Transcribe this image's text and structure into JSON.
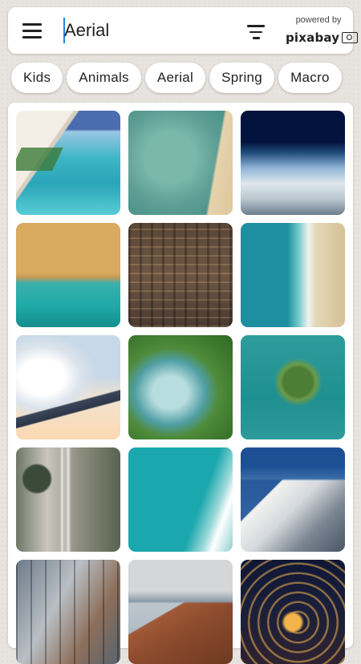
{
  "search": {
    "query": "Aerial",
    "powered_by": "powered by",
    "brand": "pixabay"
  },
  "chips": [
    "Kids",
    "Animals",
    "Aerial",
    "Spring",
    "Macro"
  ],
  "colors": {
    "background": "#e7e3df",
    "surface": "#ffffff",
    "text": "#222222",
    "caret": "#1e88e5"
  },
  "icons": {
    "menu": "menu-icon",
    "filter": "filter-icon",
    "camera": "camera-icon"
  },
  "images": [
    {
      "subject": "tropical beach aerial"
    },
    {
      "subject": "turquoise water and sand"
    },
    {
      "subject": "snowy mountains from space"
    },
    {
      "subject": "sandy beach and sea"
    },
    {
      "subject": "city buildings from above"
    },
    {
      "subject": "waves on shoreline"
    },
    {
      "subject": "airplane wing above clouds"
    },
    {
      "subject": "green lake crater"
    },
    {
      "subject": "heart-shaped island"
    },
    {
      "subject": "road through snowy forest"
    },
    {
      "subject": "boat on turquoise waves"
    },
    {
      "subject": "snowy mountain peak"
    },
    {
      "subject": "city street intersection"
    },
    {
      "subject": "volcano eruption"
    },
    {
      "subject": "highway interchange at night"
    }
  ]
}
